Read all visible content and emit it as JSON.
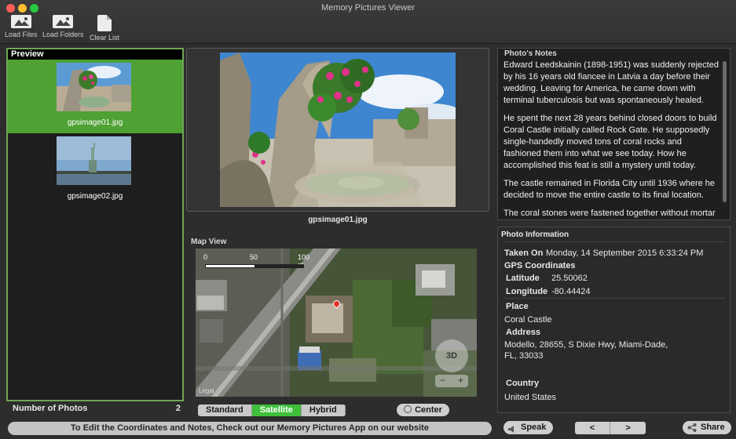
{
  "window": {
    "title": "Memory Pictures Viewer"
  },
  "toolbar": {
    "load_files": "Load Files",
    "load_folders": "Load Folders",
    "clear_list": "Clear List"
  },
  "preview": {
    "header": "Preview",
    "items": [
      {
        "filename": "gpsimage01.jpg",
        "selected": true
      },
      {
        "filename": "gpsimage02.jpg",
        "selected": false
      }
    ],
    "count_label": "Number of Photos",
    "count": "2"
  },
  "photo": {
    "caption": "gpsimage01.jpg"
  },
  "map": {
    "title": "Map View",
    "scale": [
      "0",
      "50",
      "100 m"
    ],
    "compass": "3D",
    "legal": "Legal",
    "modes": [
      "Standard",
      "Satellite",
      "Hybrid"
    ],
    "active_mode": "Satellite",
    "center_label": "Center"
  },
  "notes": {
    "title": "Photo's Notes",
    "paragraphs": [
      "Edward Leedskainin (1898-1951) was suddenly rejected by his 16 years old fiancee in Latvia a day before their wedding. Leaving for America, he came down with terminal tuberculosis but was spontaneously healed.",
      "He spent the next 28 years behind closed doors to build Coral Castle initially called Rock Gate. He supposedly single-handedly moved tons of coral rocks and fashioned them into what we see today. How he accomplished this feat is still a mystery until today.",
      "The castle remained in Florida City until 1936 where he decided to move the entire castle to its final location.",
      "The coral stones were fastened together without mortar and are set on top of each other using their weight to"
    ]
  },
  "info": {
    "title": "Photo Information",
    "taken_on_label": "Taken On",
    "taken_on": "Monday, 14 September 2015 6:33:24 PM",
    "gps_label": "GPS Coordinates",
    "latitude_label": "Latitude",
    "latitude": "25.50062",
    "longitude_label": "Longitude",
    "longitude": "-80.44424",
    "place_label": "Place",
    "place": "Coral Castle",
    "address_label": "Address",
    "address_line1": "Modello, 28655, S Dixie Hwy, Miami-Dade,",
    "address_line2": "FL, 33033",
    "country_label": "Country",
    "country": "United States"
  },
  "footer": {
    "promo": "To Edit the Coordinates and Notes, Check out our Memory Pictures App on our website",
    "speak": "Speak",
    "prev": "<",
    "next": ">",
    "share": "Share"
  },
  "colors": {
    "accent_green": "#4ea132",
    "selected_border": "#6fa655",
    "map_pin": "#e8312b"
  }
}
